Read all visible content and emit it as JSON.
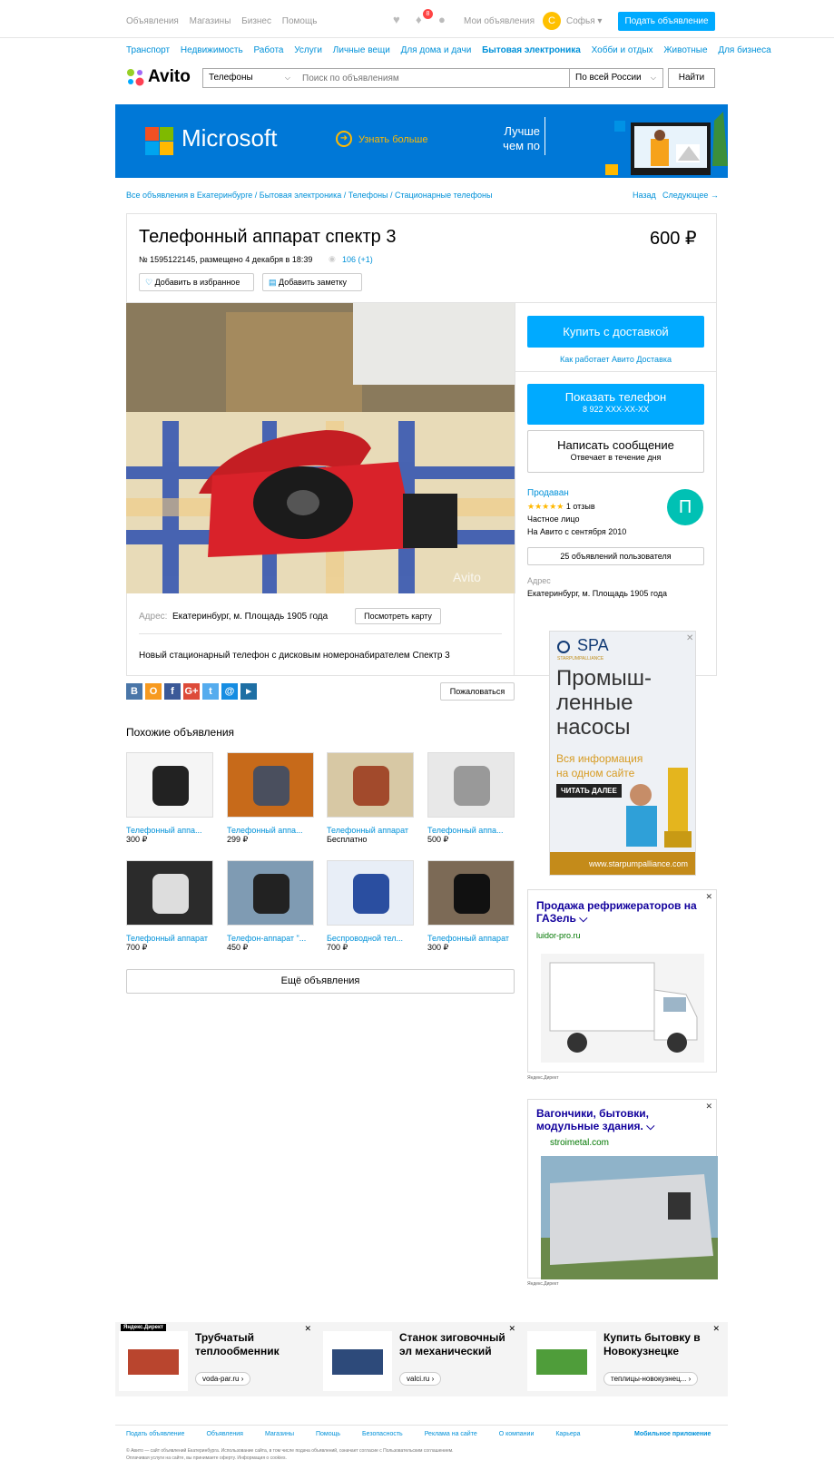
{
  "topbar": {
    "nav": [
      "Объявления",
      "Магазины",
      "Бизнес",
      "Помощь"
    ],
    "notif_count": "8",
    "my_ads": "Мои объявления",
    "user_initial": "С",
    "user_name": "Софья ▾",
    "post_button": "Подать объявление"
  },
  "categories": [
    "Транспорт",
    "Недвижимость",
    "Работа",
    "Услуги",
    "Личные вещи",
    "Для дома и дачи",
    "Бытовая электроника",
    "Хобби и отдых",
    "Животные",
    "Для бизнеса"
  ],
  "active_category": "Бытовая электроника",
  "search": {
    "logo": "Avito",
    "category_value": "Телефоны",
    "placeholder": "Поиск по объявлениям",
    "region_value": "По всей России",
    "submit": "Найти"
  },
  "banner": {
    "brand": "Microsoft",
    "cta": "Узнать больше",
    "tag1": "Лучше",
    "tag2": "чем по"
  },
  "breadcrumb": "Все объявления в Екатеринбурге / Бытовая электроника / Телефоны / Стационарные телефоны",
  "nav_back": "Назад",
  "nav_next": "Следующее →",
  "listing": {
    "title": "Телефонный аппарат спектр 3",
    "price": "600 ₽",
    "meta": "№ 1595122145, размещено 4 декабря в 18:39",
    "views": "106 (+1)",
    "fav_label": "Добавить в избранное",
    "note_label": "Добавить заметку",
    "watermark": "Avito",
    "address_label": "Адрес:",
    "address": "Екатеринбург, м. Площадь 1905 года",
    "map_button": "Посмотреть карту",
    "description": "Новый стационарный телефон с дисковым номеронабирателем Спектр 3"
  },
  "sidebar": {
    "buy_delivery": "Купить с доставкой",
    "how_delivery": "Как работает Авито Доставка",
    "show_phone": "Показать телефон",
    "phone_masked": "8 922 XXX-XX-XX",
    "write_message": "Написать сообщение",
    "reply_time": "Отвечает в течение дня",
    "seller_name": "Продаван",
    "stars": "★★★★★",
    "reviews": "1 отзыв",
    "seller_type": "Частное лицо",
    "since": "На Авито с сентября 2010",
    "avatar_letter": "П",
    "user_ads": "25 объявлений пользователя",
    "address_label": "Адрес",
    "address": "Екатеринбург, м. Площадь 1905 года"
  },
  "social": [
    "В",
    "О",
    "f",
    "G+",
    "t",
    "@",
    "▸"
  ],
  "social_colors": [
    "#4a76a8",
    "#f79a20",
    "#3b5998",
    "#dd4b39",
    "#55acee",
    "#168de2",
    "#1e6fa4"
  ],
  "complain": "Пожаловаться",
  "similar": {
    "heading": "Похожие объявления",
    "items": [
      {
        "title": "Телефонный аппа...",
        "price": "300 ₽"
      },
      {
        "title": "Телефонный аппа...",
        "price": "299 ₽"
      },
      {
        "title": "Телефонный аппарат",
        "price": "Бесплатно"
      },
      {
        "title": "Телефонный аппа...",
        "price": "500 ₽"
      },
      {
        "title": "Телефонный аппарат",
        "price": "700 ₽"
      },
      {
        "title": "Телефон-аппарат \"...",
        "price": "450 ₽"
      },
      {
        "title": "Беспроводной тел...",
        "price": "700 ₽"
      },
      {
        "title": "Телефонный аппарат",
        "price": "300 ₽"
      }
    ],
    "more": "Ещё объявления"
  },
  "ad_spa": {
    "logo": "SPA",
    "logo_sub": "STARPUMPALLIANCE",
    "h1": "Промыш-",
    "h2": "ленные",
    "h3": "насосы",
    "sub1": "Вся информация",
    "sub2": "на одном сайте",
    "cta": "ЧИТАТЬ ДАЛЕЕ",
    "url": "www.starpumpalliance.com"
  },
  "ad_gazel": {
    "title": "Продажа рефрижераторов на ГАЗель ⌵",
    "domain": "luidor-pro.ru",
    "source": "Яндекс.Директ"
  },
  "ad_wagon": {
    "title": "Вагончики, бытовки, модульные здания. ⌵",
    "domain": "stroimetal.com",
    "source": "Яндекс.Директ"
  },
  "bottom_ads": {
    "label": "Яндекс.Директ",
    "items": [
      {
        "title": "Трубчатый теплообменник",
        "domain": "voda-par.ru ›"
      },
      {
        "title": "Станок зиговочный эл механический",
        "domain": "valci.ru ›"
      },
      {
        "title": "Купить бытовку в Новокузнецке",
        "domain": "теплицы-новокузнец... ›"
      }
    ]
  },
  "footer": {
    "links": [
      "Подать объявление",
      "Объявления",
      "Магазины",
      "Помощь",
      "Безопасность",
      "Реклама на сайте",
      "О компании",
      "Карьера"
    ],
    "mobile": "Мобильное приложение",
    "copy1": "© Авито — сайт объявлений Екатеринбурга. Использование сайта, в том числе подача объявлений, означает согласие с Пользовательским соглашением.",
    "copy2": "Оплачивая услуги на сайте, вы принимаете оферту. Информация о cookies."
  }
}
